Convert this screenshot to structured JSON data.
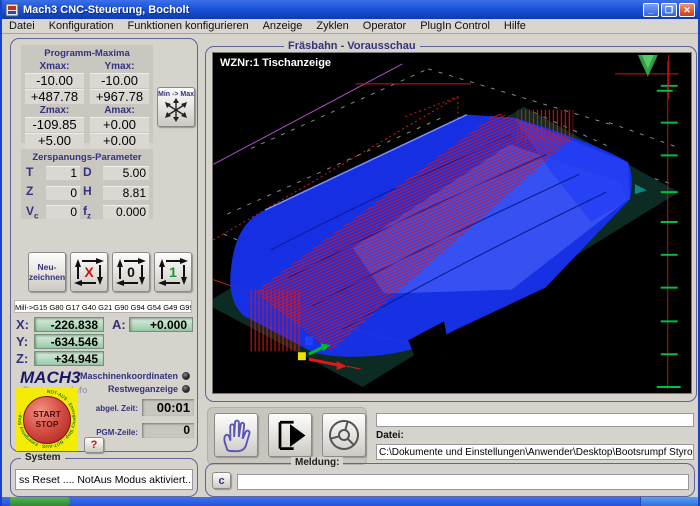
{
  "window": {
    "title": "Mach3 CNC-Steuerung, Bocholt",
    "controls": {
      "minimize": "_",
      "restore": "❐",
      "close": "✕"
    }
  },
  "menu": {
    "items": [
      "Datei",
      "Konfiguration",
      "Funktionen konfigurieren",
      "Anzeige",
      "Zyklen",
      "Operator",
      "PlugIn Control",
      "Hilfe"
    ]
  },
  "program_maxima": {
    "title": "Programm-Maxima",
    "row1_labels": [
      "Xmax:",
      "Ymax:"
    ],
    "row1_min": [
      "-10.00",
      "-10.00"
    ],
    "row1_max": [
      "+487.78",
      "+967.78"
    ],
    "row2_labels": [
      "Zmax:",
      "Amax:"
    ],
    "row2_min": [
      "-109.85",
      "+0.00"
    ],
    "row2_max": [
      "+5.00",
      "+0.00"
    ],
    "min_max_button": "Min -> Max"
  },
  "cutting_params": {
    "title": "Zerspanungs-Parameter",
    "rows": [
      {
        "l1": "T",
        "s1": "",
        "v1": "1",
        "l2": "D",
        "s2": "",
        "v2": "5.00"
      },
      {
        "l1": "Z",
        "s1": "",
        "v1": "0",
        "l2": "H",
        "s2": "",
        "v2": "8.81"
      },
      {
        "l1": "V",
        "s1": "c",
        "v1": "0",
        "l2": "f",
        "s2": "z",
        "v2": "0.000"
      }
    ]
  },
  "toolpath_buttons": {
    "redraw": "Neu-zeichnen",
    "x_glyph": "X",
    "zero_glyph": "0",
    "one_glyph": "1"
  },
  "gcode_line": "Mill->G15  G80 G17 G40 G21 G90 G94 G54 G49 G99",
  "dro": {
    "x_label": "X:",
    "x_value": "-226.838",
    "a_label": "A:",
    "a_value": "+0.000",
    "y_label": "Y:",
    "y_value": "-634.546",
    "z_label": "Z:",
    "z_value": "+34.945"
  },
  "status": {
    "logo": "MACH3",
    "logo_sub": "Programm-Info",
    "machine_coords_label": "Maschinenkoordinaten",
    "dtg_label": "Restweganzeige",
    "elapsed_label": "abgel. Zeit:",
    "elapsed_value": "00:01",
    "pgm_line_label": "PGM-Zeile:",
    "pgm_line_value": "0",
    "estop_line1": "START",
    "estop_line2": "STOP",
    "estop_ring": "NOT-AUS · Emergency Stop · NOT-AUS · Emergency Stop ·",
    "help_button": "?"
  },
  "system": {
    "title": "System",
    "message": "ss Reset .... NotAus Modus aktiviert....."
  },
  "preview": {
    "title": "Fräsbahn - Vorausschau",
    "overlay_label": "WZNr:1  Tischanzeige"
  },
  "file_panel": {
    "field_value": "",
    "datei_label": "Datei:",
    "path": "C:\\Dokumente und Einstellungen\\Anwender\\Desktop\\Bootsrumpf Styrod"
  },
  "meldung": {
    "label": "Meldung:",
    "clear_button": "c",
    "value": ""
  },
  "colors": {
    "accent_navy": "#33337f",
    "dro_green": "#b7dec0",
    "estop_yellow": "#f4ec07",
    "estop_red": "#c93030",
    "hull_blue": "#1732ee",
    "toolpath_red": "#e01212",
    "table_green": "#0c2b22",
    "ruler_red": "#cc1010",
    "tick_green": "#00c040",
    "titlebar_blue": "#1c53d8"
  }
}
